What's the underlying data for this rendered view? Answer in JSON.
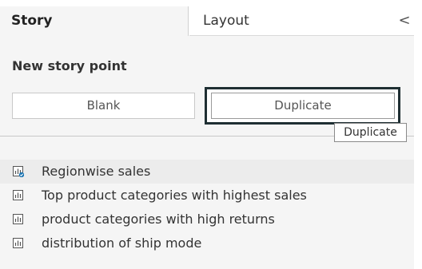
{
  "tabs": {
    "story_label": "Story",
    "layout_label": "Layout",
    "collapse_glyph": "<"
  },
  "new_story_point": {
    "title": "New story point",
    "blank_label": "Blank",
    "duplicate_label": "Duplicate"
  },
  "tooltip": {
    "text": "Duplicate"
  },
  "sheets": [
    {
      "label": "Regionwise sales",
      "icon": "bar-chart-sheet-icon-with-check",
      "active": true
    },
    {
      "label": "Top product categories with highest sales",
      "icon": "bar-chart-sheet-icon",
      "active": false
    },
    {
      "label": "product categories with high returns",
      "icon": "bar-chart-sheet-icon",
      "active": false
    },
    {
      "label": "distribution of ship mode",
      "icon": "bar-chart-sheet-icon",
      "active": false
    }
  ],
  "colors": {
    "panel_bg": "#f5f5f5",
    "focus_border": "#1f2f33",
    "check_badge": "#1f77b4"
  }
}
